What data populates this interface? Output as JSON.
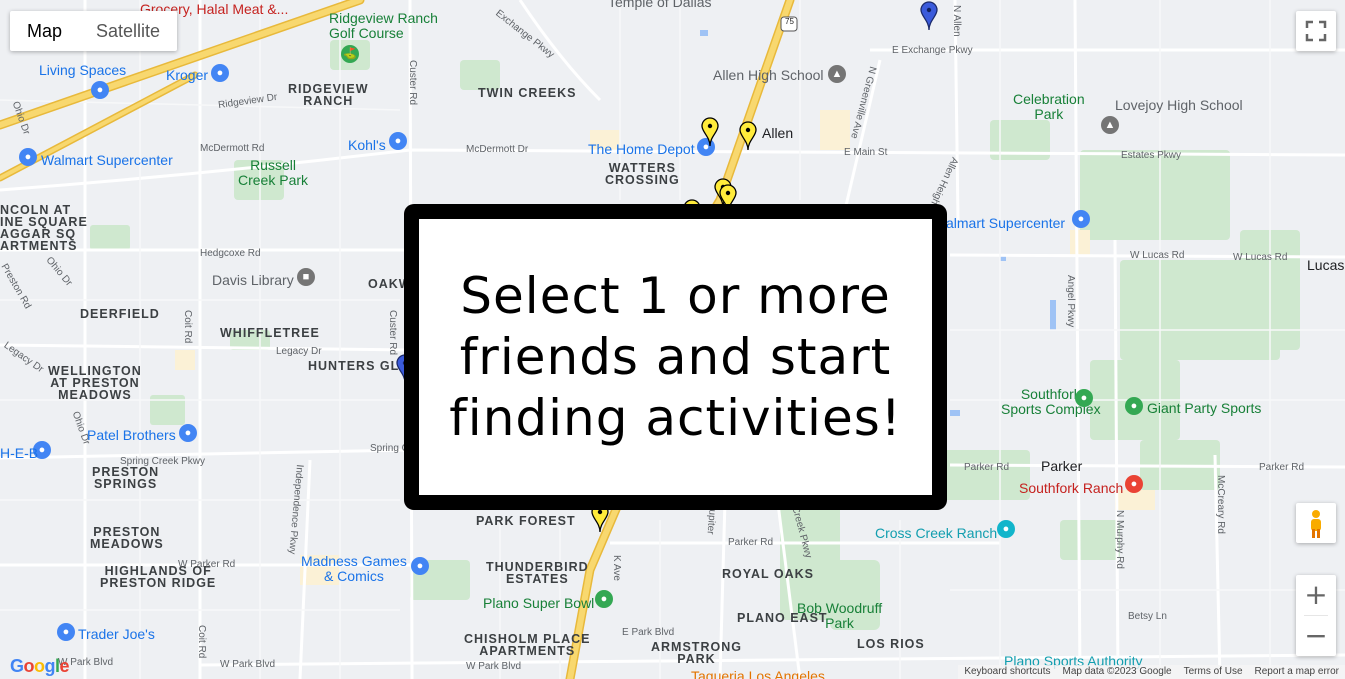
{
  "map_type": {
    "map_label": "Map",
    "satellite_label": "Satellite",
    "selected": "Map"
  },
  "overlay": {
    "message": "Select 1 or more\nfriends and start\nfinding activities!"
  },
  "areas": [
    {
      "name": "RIDGEVIEW\nRANCH"
    },
    {
      "name": "TWIN CREEKS"
    },
    {
      "name": "WATTERS\nCROSSING"
    },
    {
      "name": "DEERFIELD"
    },
    {
      "name": "WHIFFLETREE"
    },
    {
      "name": "OAKW"
    },
    {
      "name": "HUNTERS GLE"
    },
    {
      "name": "WELLINGTON\nAT PRESTON\nMEADOWS"
    },
    {
      "name": "PRESTON\nSPRINGS"
    },
    {
      "name": "PRESTON\nMEADOWS"
    },
    {
      "name": "HIGHLANDS OF\nPRESTON RIDGE"
    },
    {
      "name": "PARK FOREST"
    },
    {
      "name": "THUNDERBIRD\nESTATES"
    },
    {
      "name": "ROYAL OAKS"
    },
    {
      "name": "PLANO EAST"
    },
    {
      "name": "LOS RIOS"
    },
    {
      "name": "CHISHOLM PLACE\nAPARTMENTS"
    },
    {
      "name": "ARMSTRONG\nPARK"
    },
    {
      "name": "NCOLN AT\nINE SQUARE\nAGGAR SQ\nARTMENTS"
    }
  ],
  "towns": [
    {
      "name": "Allen"
    },
    {
      "name": "Parker"
    },
    {
      "name": "Lucas"
    }
  ],
  "pois": [
    {
      "name": "Ridgeview Ranch\nGolf Course",
      "kind": "green",
      "icon": "golf-icon"
    },
    {
      "name": "Grocery, Halal Meat &...",
      "kind": "red",
      "icon": "cart-icon"
    },
    {
      "name": "Temple of Dallas",
      "kind": "gray",
      "icon": "place-icon"
    },
    {
      "name": "Living Spaces",
      "kind": "blue",
      "icon": "shopping-bag-icon"
    },
    {
      "name": "Kroger",
      "kind": "blue",
      "icon": "cart-icon"
    },
    {
      "name": "Allen High School",
      "kind": "gray",
      "icon": "school-icon"
    },
    {
      "name": "Kohl's",
      "kind": "blue",
      "icon": "shopping-bag-icon"
    },
    {
      "name": "The Home Depot",
      "kind": "blue",
      "icon": "shopping-bag-icon"
    },
    {
      "name": "Walmart Supercenter",
      "kind": "blue",
      "icon": "shopping-bag-icon"
    },
    {
      "name": "Russell\nCreek Park",
      "kind": "green",
      "icon": "park-icon"
    },
    {
      "name": "Celebration\nPark",
      "kind": "green",
      "icon": "park-icon"
    },
    {
      "name": "Lovejoy High School",
      "kind": "gray",
      "icon": "school-icon"
    },
    {
      "name": "almart Supercenter",
      "kind": "blue",
      "icon": "shopping-bag-icon"
    },
    {
      "name": "Davis Library",
      "kind": "gray",
      "icon": "book-icon"
    },
    {
      "name": "Southfork\nSports Complex",
      "kind": "green",
      "icon": "park-icon"
    },
    {
      "name": "Giant Party Sports",
      "kind": "green",
      "icon": "park-icon"
    },
    {
      "name": "Patel Brothers",
      "kind": "blue",
      "icon": "cart-icon"
    },
    {
      "name": "Southfork Ranch",
      "kind": "red",
      "icon": "hotel-icon"
    },
    {
      "name": "Cross Creek Ranch",
      "kind": "teal",
      "icon": "camera-icon"
    },
    {
      "name": "Madness Games\n& Comics",
      "kind": "blue",
      "icon": "shopping-bag-icon"
    },
    {
      "name": "Plano Super Bowl",
      "kind": "green",
      "icon": "bowling-icon"
    },
    {
      "name": "Bob Woodruff\nPark",
      "kind": "green",
      "icon": "park-icon"
    },
    {
      "name": "Trader Joe's",
      "kind": "blue",
      "icon": "cart-icon"
    },
    {
      "name": "Plano Sports Authority",
      "kind": "teal",
      "icon": "place-icon"
    },
    {
      "name": "Taqueria Los Angeles",
      "kind": "red",
      "icon": "restaurant-icon"
    },
    {
      "name": "H-E-B",
      "kind": "blue",
      "icon": "cart-icon"
    }
  ],
  "streets": [
    "Exchange Pkwy",
    "E Exchange Pkwy",
    "Ridgeview Dr",
    "McDermott Rd",
    "McDermott Dr",
    "E Main St",
    "Estates Pkwy",
    "W Lucas Rd",
    "Hedgcoxe Rd",
    "Legacy Dr",
    "Spring Creek Pkwy",
    "Spring Cr",
    "Parker Rd",
    "W Parker Rd",
    "E Park Blvd",
    "W Park Blvd",
    "Betsy Ln",
    "Custer Rd",
    "Coit Rd",
    "Ohio Dr",
    "Preston Rd",
    "Independence Pkwy",
    "Angel Pkwy",
    "N Murphy Rd",
    "McCreary Rd",
    "N Greenville Ave",
    "Allen Heights Dr",
    "N Allen",
    "Jupiter",
    "Creek Pkwy",
    "K Ave",
    "75"
  ],
  "markers": {
    "friend_pin_color": "#ffeb3b",
    "user_pin_color": "#3b5bdb",
    "friend_pin_count": 8
  },
  "colors": {
    "water": "#9fc3f5",
    "park": "#c8e6c9",
    "highway": "#f8d46f",
    "road": "#ffffff",
    "land": "#eef0f3"
  },
  "footer": {
    "keyboard": "Keyboard shortcuts",
    "data": "Map data ©2023 Google",
    "terms": "Terms of Use",
    "report": "Report a map error"
  },
  "zoom": {
    "in_label": "+",
    "out_label": "−"
  },
  "google_logo": "Google"
}
